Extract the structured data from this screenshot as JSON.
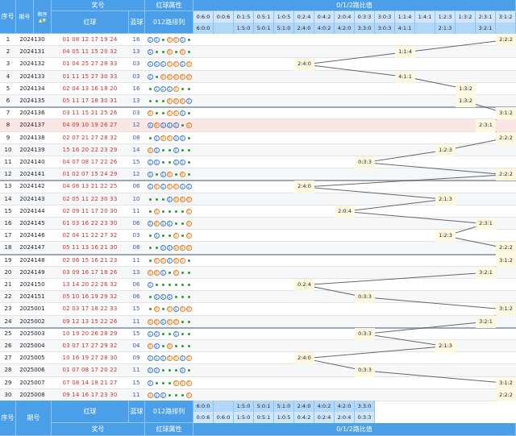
{
  "header": {
    "seq": "序号",
    "period": "期号",
    "order": "顺序",
    "prize": "奖号",
    "red_ball": "红球",
    "blue_ball": "蓝球",
    "red_attr": "红球属性",
    "arrangement": "012路排列",
    "ratio_title": "0/1/2路比值",
    "ratios_top": [
      "0:6:0",
      "0:0:6",
      "0:1:5",
      "0:5:1",
      "1:0:5",
      "0:2:4",
      "0:4:2",
      "2:0:4",
      "0:3:3",
      "3:0:3",
      "1:1:4",
      "1:4:1",
      "1:2:3",
      "1:3:2",
      "2:3:1",
      "3:1:2"
    ],
    "ratios_bottom": [
      "6:0:0",
      "",
      "1:5:0",
      "5:0:1",
      "5:1:0",
      "2:4:0",
      "4:0:2",
      "4:2:0",
      "3:3:0",
      "3:0:3",
      "4:1:1",
      "",
      "2:1:3",
      "",
      "3:2:1",
      ""
    ]
  },
  "footer": {
    "seq": "序号",
    "period": "期号",
    "red_ball": "红球",
    "blue_ball": "蓝球",
    "arrangement": "012路排列",
    "prize": "奖号",
    "red_attr": "红球属性",
    "ratio_title": "0/1/2路比值",
    "ratios_top": [
      "6:0:0",
      "",
      "1:5:0",
      "5:0:1",
      "5:1:0",
      "2:4:0",
      "4:0:2",
      "4:2:0",
      "3:3:0"
    ],
    "ratios_bottom": [
      "0:0:6",
      "0:6:0",
      "1:5:0",
      "0:5:1",
      "1:0:5",
      "0:4:2",
      "0:2:4",
      "2:0:4",
      "0:3:3"
    ]
  },
  "rows": [
    {
      "seq": "1",
      "period": "2024130",
      "red": "01 08 12 17 19 24",
      "blue": "16",
      "pattern": "1120012",
      "ratio": "2:2:2"
    },
    {
      "seq": "2",
      "period": "2024131",
      "red": "04 05 11 15 20 32",
      "blue": "13",
      "pattern": "1220202",
      "ratio": "1:1:4"
    },
    {
      "seq": "3",
      "period": "2024132",
      "red": "01 04 25 27 28 33",
      "blue": "03",
      "pattern": "1110010",
      "ratio": "2:4:0"
    },
    {
      "seq": "4",
      "period": "2024133",
      "red": "01 11 15 27 30 33",
      "blue": "03",
      "pattern": "1200000",
      "ratio": "4:1:1"
    },
    {
      "seq": "5",
      "period": "2024134",
      "red": "02 04 13 16 18 20",
      "blue": "16",
      "pattern": "2111022",
      "ratio": "1:3:2"
    },
    {
      "seq": "6",
      "period": "2024135",
      "red": "05 11 17 18 30 31",
      "blue": "13",
      "pattern": "2220001",
      "ratio": "1:3:2"
    },
    {
      "seq": "7",
      "period": "2024136",
      "red": "03 11 15 21 25 26",
      "blue": "03",
      "pattern": "0220012",
      "ratio": "3:1:2"
    },
    {
      "seq": "8",
      "period": "2024137",
      "red": "04 09 10 19 26 27",
      "blue": "12",
      "pattern": "1011120",
      "ratio": "2:3:1"
    },
    {
      "seq": "9",
      "period": "2024138",
      "red": "02 07 21 27 28 32",
      "blue": "08",
      "pattern": "2100112",
      "ratio": "2:2:2"
    },
    {
      "seq": "10",
      "period": "2024139",
      "red": "15 16 20 22 23 29",
      "blue": "14",
      "pattern": "0122122",
      "ratio": "1:2:3"
    },
    {
      "seq": "11",
      "period": "2024140",
      "red": "04 07 08 17 22 26",
      "blue": "15",
      "pattern": "1122112",
      "ratio": "0:3:3"
    },
    {
      "seq": "12",
      "period": "2024141",
      "red": "01 02 07 15 24 29",
      "blue": "12",
      "pattern": "1210202",
      "ratio": "2:2:2"
    },
    {
      "seq": "13",
      "period": "2024142",
      "red": "04 06 13 21 22 25",
      "blue": "06",
      "pattern": "1010011",
      "ratio": "2:4:0"
    },
    {
      "seq": "14",
      "period": "2024143",
      "red": "02 05 11 22 30 33",
      "blue": "10",
      "pattern": "2221000",
      "ratio": "2:1:3"
    },
    {
      "seq": "15",
      "period": "2024144",
      "red": "02 09 11 17 20 30",
      "blue": "11",
      "pattern": "2022220",
      "ratio": "2:0:4"
    },
    {
      "seq": "16",
      "period": "2024145",
      "red": "01 03 16 22 23 30",
      "blue": "06",
      "pattern": "1011220",
      "ratio": "2:3:1"
    },
    {
      "seq": "17",
      "period": "2024146",
      "red": "02 04 11 22 27 32",
      "blue": "03",
      "pattern": "2122020",
      "ratio": "1:2:3"
    },
    {
      "seq": "18",
      "period": "2024147",
      "red": "05 11 13 16 21 30",
      "blue": "08",
      "pattern": "2211000",
      "ratio": "2:2:2"
    },
    {
      "seq": "19",
      "period": "2024148",
      "red": "02 06 15 16 21 23",
      "blue": "11",
      "pattern": "2001002",
      "ratio": "3:1:2"
    },
    {
      "seq": "20",
      "period": "2024149",
      "red": "03 09 16 17 18 26",
      "blue": "13",
      "pattern": "0012022",
      "ratio": "3:2:1"
    },
    {
      "seq": "21",
      "period": "2024150",
      "red": "13 14 20 22 26 32",
      "blue": "06",
      "pattern": "1222222",
      "ratio": "0:2:4"
    },
    {
      "seq": "22",
      "period": "2024151",
      "red": "05 10 16 19 29 32",
      "blue": "06",
      "pattern": "2111222",
      "ratio": "0:3:3"
    },
    {
      "seq": "23",
      "period": "2025001",
      "red": "02 03 17 18 22 33",
      "blue": "15",
      "pattern": "2020100",
      "ratio": "3:1:2"
    },
    {
      "seq": "24",
      "period": "2025002",
      "red": "09 12 13 15 22 26",
      "blue": "11",
      "pattern": "0010022",
      "ratio": "3:2:1"
    },
    {
      "seq": "25",
      "period": "2025003",
      "red": "10 19 20 26 28 29",
      "blue": "15",
      "pattern": "1122122",
      "ratio": "0:3:3"
    },
    {
      "seq": "26",
      "period": "2025004",
      "red": "03 07 17 27 29 32",
      "blue": "04",
      "pattern": "0120222",
      "ratio": "2:1:3"
    },
    {
      "seq": "27",
      "period": "2025005",
      "red": "10 16 19 27 28 30",
      "blue": "09",
      "pattern": "1110010",
      "ratio": "2:4:0"
    },
    {
      "seq": "28",
      "period": "2025006",
      "red": "01 07 08 17 20 22",
      "blue": "11",
      "pattern": "1122212",
      "ratio": "0:3:3"
    },
    {
      "seq": "29",
      "period": "2025007",
      "red": "07 08 14 18 21 27",
      "blue": "15",
      "pattern": "1222000",
      "ratio": "3:1:2"
    },
    {
      "seq": "30",
      "period": "2025008",
      "red": "09 14 16 17 23 30",
      "blue": "11",
      "pattern": "0112220",
      "ratio": "2:2:2"
    }
  ],
  "colors": {
    "header_blue": "#4a9fe8",
    "red_number": "#c8302c",
    "blue_number": "#3b56a6",
    "highlight_row": "#fbe6e6",
    "line": "#666666"
  }
}
